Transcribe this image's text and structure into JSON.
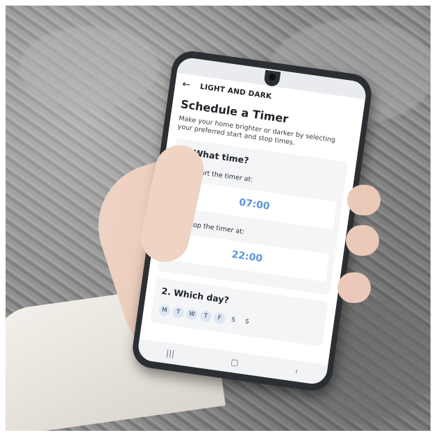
{
  "app": {
    "title": "LIGHT AND DARK"
  },
  "page": {
    "heading": "Schedule a Timer",
    "description": "Make your home brighter or darker by selecting your preferred start and stop times."
  },
  "section_time": {
    "heading": "1. What time?",
    "start_label": "Start the timer at:",
    "start_value": "07:00",
    "stop_label": "Stop the timer at:",
    "stop_value": "22:00"
  },
  "section_day": {
    "heading": "2. Which day?",
    "days": [
      {
        "label": "M",
        "selected": true
      },
      {
        "label": "T",
        "selected": true
      },
      {
        "label": "W",
        "selected": true
      },
      {
        "label": "T",
        "selected": true
      },
      {
        "label": "F",
        "selected": true
      },
      {
        "label": "S",
        "selected": false
      },
      {
        "label": "S",
        "selected": false
      }
    ]
  },
  "colors": {
    "accent": "#6fa3e0",
    "time_text": "#5b95d8",
    "day_selected": "#dbe7f5"
  },
  "icons": {
    "back": "arrow-left-icon",
    "check": "check-circle-icon",
    "nav": [
      "recents-icon",
      "home-icon",
      "back-nav-icon"
    ]
  }
}
